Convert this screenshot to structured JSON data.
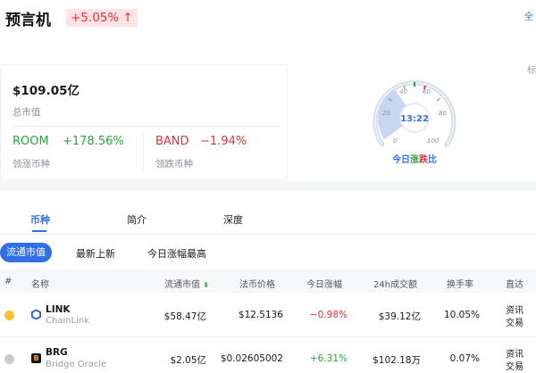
{
  "header": {
    "title": "预言机",
    "change": "+5.05%",
    "change_arrow": "↑",
    "right_fragment": "全"
  },
  "summary": {
    "market_cap": "$109.05亿",
    "market_cap_label": "总市值",
    "top_gainer": {
      "name": "ROOM",
      "pct": "+178.56%",
      "label": "领涨币种"
    },
    "top_loser": {
      "name": "BAND",
      "pct": "−1.94%",
      "label": "领跌币种"
    },
    "side_fragment": "标"
  },
  "gauge": {
    "time": "13:22",
    "ticks": [
      "0",
      "20",
      "40",
      "60",
      "80",
      "100"
    ],
    "label_parts": [
      "今日",
      "涨",
      "跌",
      "比"
    ],
    "colors": {
      "up": "#2aa53c",
      "down": "#e0323a",
      "ring": "#cfd8e3"
    }
  },
  "tabs": [
    "币种",
    "简介",
    "深度"
  ],
  "subtabs": [
    "流通市值",
    "最新上新",
    "今日涨幅最高"
  ],
  "table": {
    "headers": [
      "#",
      "名称",
      "流通市值",
      "法币价格",
      "今日涨幅",
      "24h成交额",
      "换手率",
      "直达"
    ],
    "sort_icon": "sort-down-icon",
    "rows": [
      {
        "symbol": "LINK",
        "name": "ChainLink",
        "mcap": "$58.47亿",
        "price": "$12.5136",
        "change": "−0.98%",
        "volume": "$39.12亿",
        "turnover": "10.05%",
        "links": [
          "资讯",
          "交易"
        ]
      },
      {
        "symbol": "BRG",
        "name": "Bridge Oracle",
        "mcap": "$2.05亿",
        "price": "$0.02605002",
        "change": "+6.31%",
        "volume": "$102.18万",
        "turnover": "0.07%",
        "links": [
          "资讯",
          "交易"
        ]
      }
    ]
  }
}
